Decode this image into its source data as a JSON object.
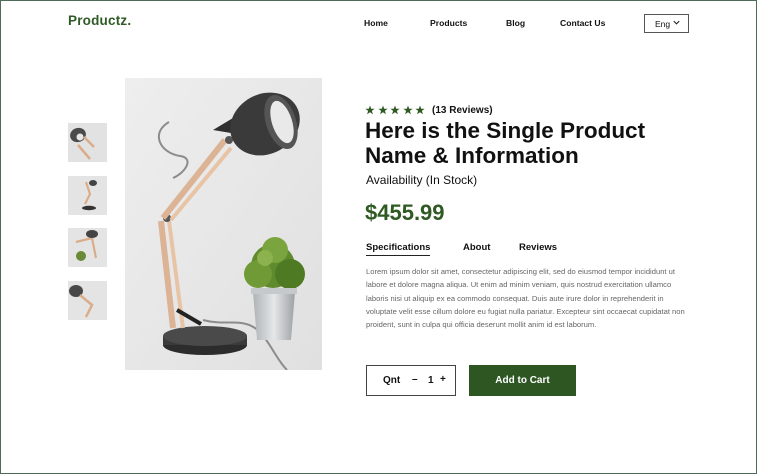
{
  "header": {
    "brand": "Productz.",
    "nav": [
      "Home",
      "Products",
      "Blog",
      "Contact Us"
    ],
    "language": "Eng"
  },
  "product": {
    "rating": 5,
    "reviews": "(13 Reviews)",
    "title": "Here is the Single Product Name & Information",
    "availability": "Availability (In Stock)",
    "price": "$455.99",
    "tabs": [
      "Specifications",
      "About",
      "Reviews"
    ],
    "active_tab": "Specifications",
    "description": "Lorem ipsum dolor sit amet, consectetur adipiscing elit, sed do eiusmod tempor incididunt ut labore et dolore magna aliqua. Ut enim ad minim veniam, quis nostrud exercitation ullamco laboris nisi ut aliquip ex ea commodo consequat. Duis aute irure dolor in reprehenderit in voluptate velit esse cillum dolore eu fugiat nulla pariatur. Excepteur sint occaecat cupidatat non proident, sunt in culpa qui officia deserunt mollit anim id est laborum.",
    "quantity_label": "Qnt",
    "quantity": "1",
    "minus": "–",
    "plus": "+",
    "add_to_cart": "Add to Cart"
  },
  "colors": {
    "brand": "#2f5a24",
    "button": "#2e5623",
    "border": "#4e6b56"
  },
  "icons": {
    "star": "star-icon",
    "language_chevron": "chevron-down-icon"
  }
}
